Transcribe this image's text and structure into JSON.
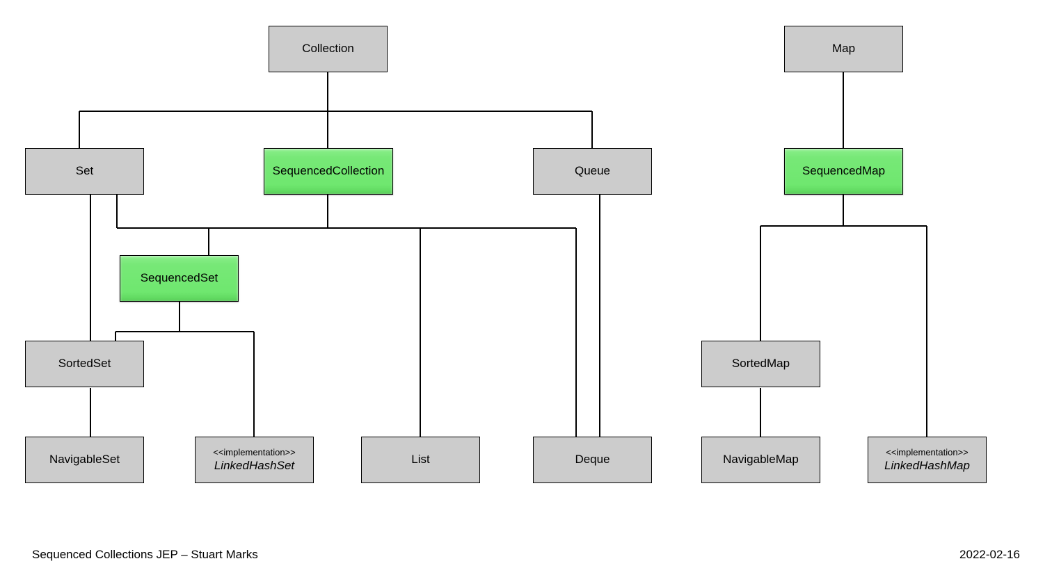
{
  "nodes": {
    "collection": "Collection",
    "map": "Map",
    "set": "Set",
    "sequencedCollection": "SequencedCollection",
    "queue": "Queue",
    "sequencedMap": "SequencedMap",
    "sequencedSet": "SequencedSet",
    "sortedSet": "SortedSet",
    "sortedMap": "SortedMap",
    "navigableSet": "NavigableSet",
    "linkedHashSetStereo": "<<implementation>>",
    "linkedHashSet": "LinkedHashSet",
    "list": "List",
    "deque": "Deque",
    "navigableMap": "NavigableMap",
    "linkedHashMapStereo": "<<implementation>>",
    "linkedHashMap": "LinkedHashMap"
  },
  "footer": {
    "left": "Sequenced Collections JEP – Stuart Marks",
    "right": "2022-02-16"
  }
}
